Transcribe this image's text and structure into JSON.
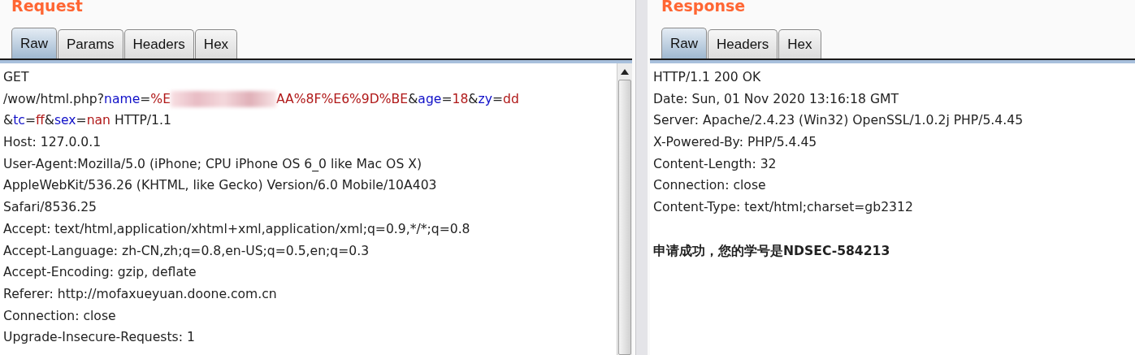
{
  "request": {
    "title": "Request",
    "tabs": [
      {
        "label": "Raw",
        "selected": true
      },
      {
        "label": "Params",
        "selected": false
      },
      {
        "label": "Headers",
        "selected": false
      },
      {
        "label": "Hex",
        "selected": false
      }
    ],
    "lines": [
      [
        {
          "kind": "text",
          "text": "GET"
        }
      ],
      [
        {
          "kind": "text",
          "text": "/wow/html.php?"
        },
        {
          "kind": "key",
          "text": "name"
        },
        {
          "kind": "text",
          "text": "="
        },
        {
          "kind": "value",
          "text": "%E"
        },
        {
          "kind": "redacted"
        },
        {
          "kind": "value",
          "text": "AA%8F%E6%9D%BE"
        },
        {
          "kind": "text",
          "text": "&"
        },
        {
          "kind": "key",
          "text": "age"
        },
        {
          "kind": "text",
          "text": "="
        },
        {
          "kind": "value",
          "text": "18"
        },
        {
          "kind": "text",
          "text": "&"
        },
        {
          "kind": "key",
          "text": "zy"
        },
        {
          "kind": "text",
          "text": "="
        },
        {
          "kind": "value",
          "text": "dd"
        }
      ],
      [
        {
          "kind": "text",
          "text": "&"
        },
        {
          "kind": "key",
          "text": "tc"
        },
        {
          "kind": "text",
          "text": "="
        },
        {
          "kind": "value",
          "text": "ff"
        },
        {
          "kind": "text",
          "text": "&"
        },
        {
          "kind": "key",
          "text": "sex"
        },
        {
          "kind": "text",
          "text": "="
        },
        {
          "kind": "value",
          "text": "nan"
        },
        {
          "kind": "text",
          "text": " HTTP/1.1"
        }
      ],
      [
        {
          "kind": "text",
          "text": "Host: 127.0.0.1"
        }
      ],
      [
        {
          "kind": "text",
          "text": "User-Agent:Mozilla/5.0 (iPhone; CPU iPhone OS 6_0 like Mac OS X)"
        }
      ],
      [
        {
          "kind": "text",
          "text": "AppleWebKit/536.26 (KHTML, like Gecko) Version/6.0 Mobile/10A403"
        }
      ],
      [
        {
          "kind": "text",
          "text": "Safari/8536.25"
        }
      ],
      [
        {
          "kind": "text",
          "text": "Accept: text/html,application/xhtml+xml,application/xml;q=0.9,*/*;q=0.8"
        }
      ],
      [
        {
          "kind": "text",
          "text": "Accept-Language: zh-CN,zh;q=0.8,en-US;q=0.5,en;q=0.3"
        }
      ],
      [
        {
          "kind": "text",
          "text": "Accept-Encoding: gzip, deflate"
        }
      ],
      [
        {
          "kind": "text",
          "text": "Referer: http://mofaxueyuan.doone.com.cn"
        }
      ],
      [
        {
          "kind": "text",
          "text": "Connection: close"
        }
      ],
      [
        {
          "kind": "text",
          "text": "Upgrade-Insecure-Requests: 1"
        }
      ]
    ]
  },
  "response": {
    "title": "Response",
    "tabs": [
      {
        "label": "Raw",
        "selected": true
      },
      {
        "label": "Headers",
        "selected": false
      },
      {
        "label": "Hex",
        "selected": false
      }
    ],
    "lines": [
      {
        "kind": "text",
        "text": "HTTP/1.1 200 OK"
      },
      {
        "kind": "text",
        "text": "Date: Sun, 01 Nov 2020 13:16:18 GMT"
      },
      {
        "kind": "text",
        "text": "Server: Apache/2.4.23 (Win32) OpenSSL/1.0.2j PHP/5.4.45"
      },
      {
        "kind": "text",
        "text": "X-Powered-By: PHP/5.4.45"
      },
      {
        "kind": "text",
        "text": "Content-Length: 32"
      },
      {
        "kind": "text",
        "text": "Connection: close"
      },
      {
        "kind": "text",
        "text": "Content-Type: text/html;charset=gb2312"
      },
      {
        "kind": "blank"
      },
      {
        "kind": "body",
        "text": "申请成功，您的学号是NDSEC-584213"
      }
    ]
  }
}
